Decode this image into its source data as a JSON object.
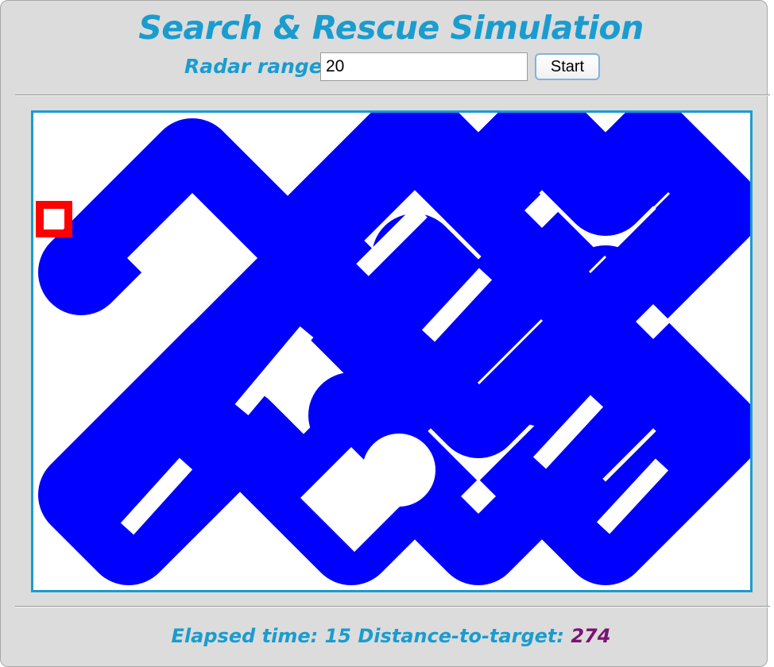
{
  "app": {
    "title": "Search & Rescue Simulation"
  },
  "controls": {
    "radar_label": "Radar range",
    "radar_value": "20",
    "start_label": "Start"
  },
  "status": {
    "elapsed_label": "Elapsed time:",
    "elapsed_value": "15",
    "distance_label": "Distance-to-target:",
    "distance_value": "274"
  },
  "colors": {
    "accent": "#1a9ccf",
    "explored_area": "#0000ff",
    "agent": "#ff0000",
    "distance_value": "#7a1372",
    "panel_background": "#dcdcdc"
  }
}
